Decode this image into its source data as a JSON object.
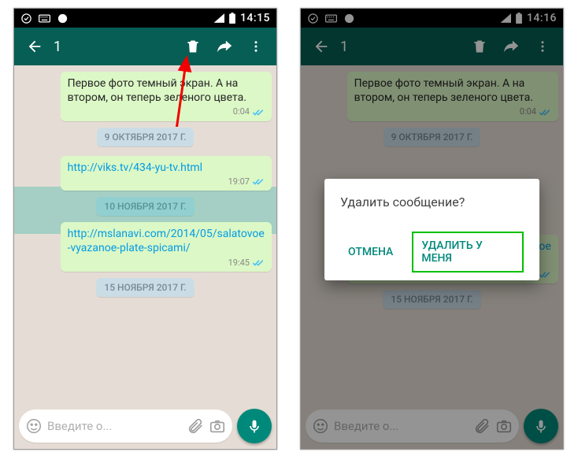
{
  "left": {
    "status_time": "14:15",
    "selected_count": "1",
    "messages": {
      "m1_text": "Первое фото темный экран. А на втором, он теперь зеленого цвета.",
      "m1_time": "0:04",
      "date1": "9 ОКТЯБРЯ 2017 Г.",
      "m2_link": "http://viks.tv/434-yu-tv.html",
      "m2_time": "19:07",
      "date2": "10 НОЯБРЯ 2017 Г.",
      "m3_link": "http://mslanavi.com/2014/05/salatovoe-vyazanoe-plate-spicami/",
      "m3_time": "19:45",
      "date3": "15 НОЯБРЯ 2017 Г."
    },
    "input_placeholder": "Введите о..."
  },
  "right": {
    "status_time": "14:16",
    "dialog_title": "Удалить сообщение?",
    "dialog_cancel": "ОТМЕНА",
    "dialog_delete": "УДАЛИТЬ У МЕНЯ"
  }
}
